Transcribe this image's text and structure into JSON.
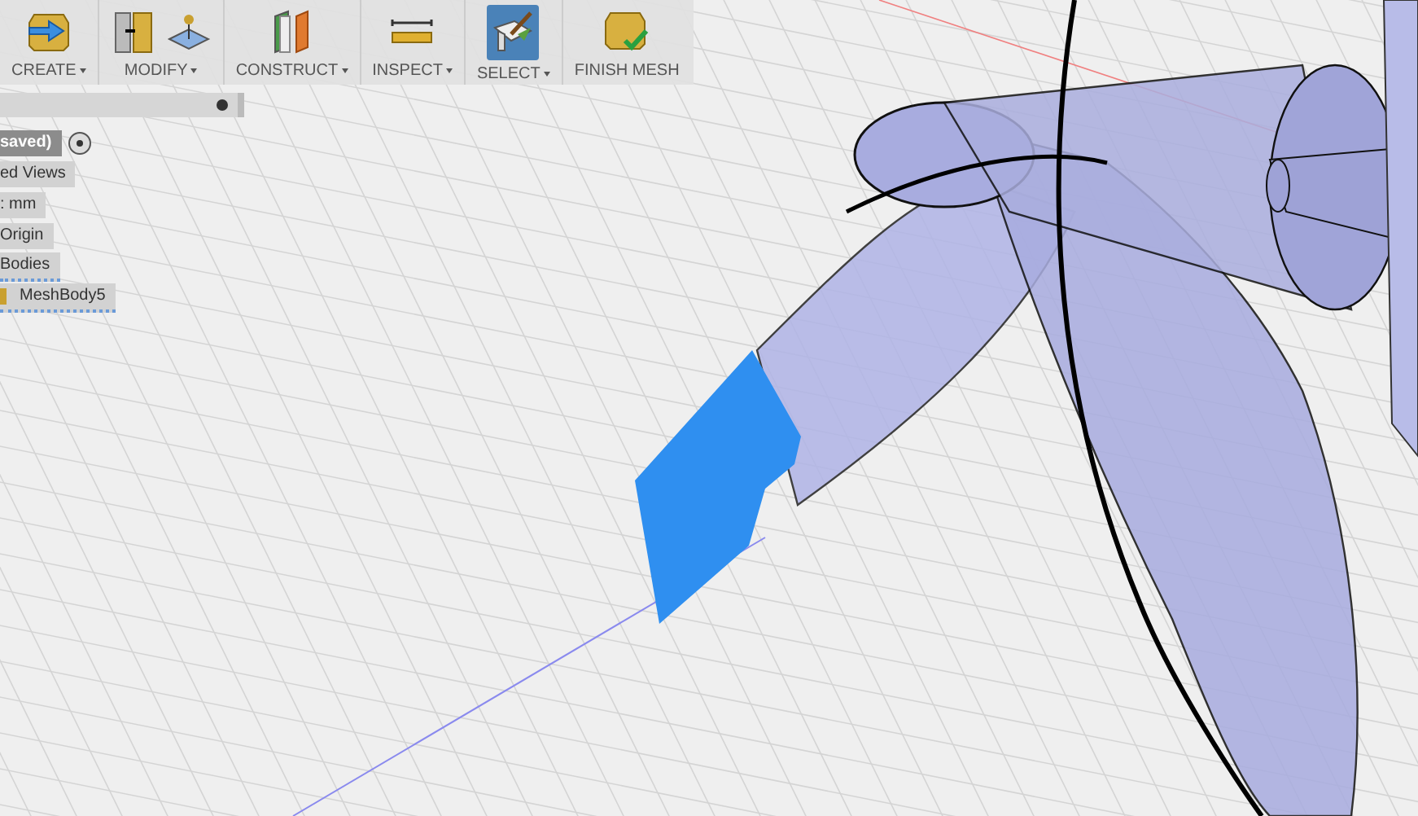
{
  "toolbar": {
    "groups": [
      {
        "kind": "create",
        "label": "CREATE",
        "dropdown": true,
        "selected": false
      },
      {
        "kind": "modify",
        "label": "MODIFY",
        "dropdown": true,
        "selected": false
      },
      {
        "kind": "construct",
        "label": "CONSTRUCT",
        "dropdown": true,
        "selected": false
      },
      {
        "kind": "inspect",
        "label": "INSPECT",
        "dropdown": true,
        "selected": false
      },
      {
        "kind": "select",
        "label": "SELECT",
        "dropdown": true,
        "selected": true
      },
      {
        "kind": "finish",
        "label": "FINISH MESH",
        "dropdown": false,
        "selected": false
      }
    ]
  },
  "browser": {
    "items": [
      {
        "kind": "document",
        "label": "saved)"
      },
      {
        "kind": "folder",
        "label": "ed Views"
      },
      {
        "kind": "folder",
        "label": ": mm"
      },
      {
        "kind": "folder",
        "label": "Origin"
      },
      {
        "kind": "bodies",
        "label": "Bodies"
      },
      {
        "kind": "mesh",
        "label": "MeshBody5"
      }
    ]
  }
}
